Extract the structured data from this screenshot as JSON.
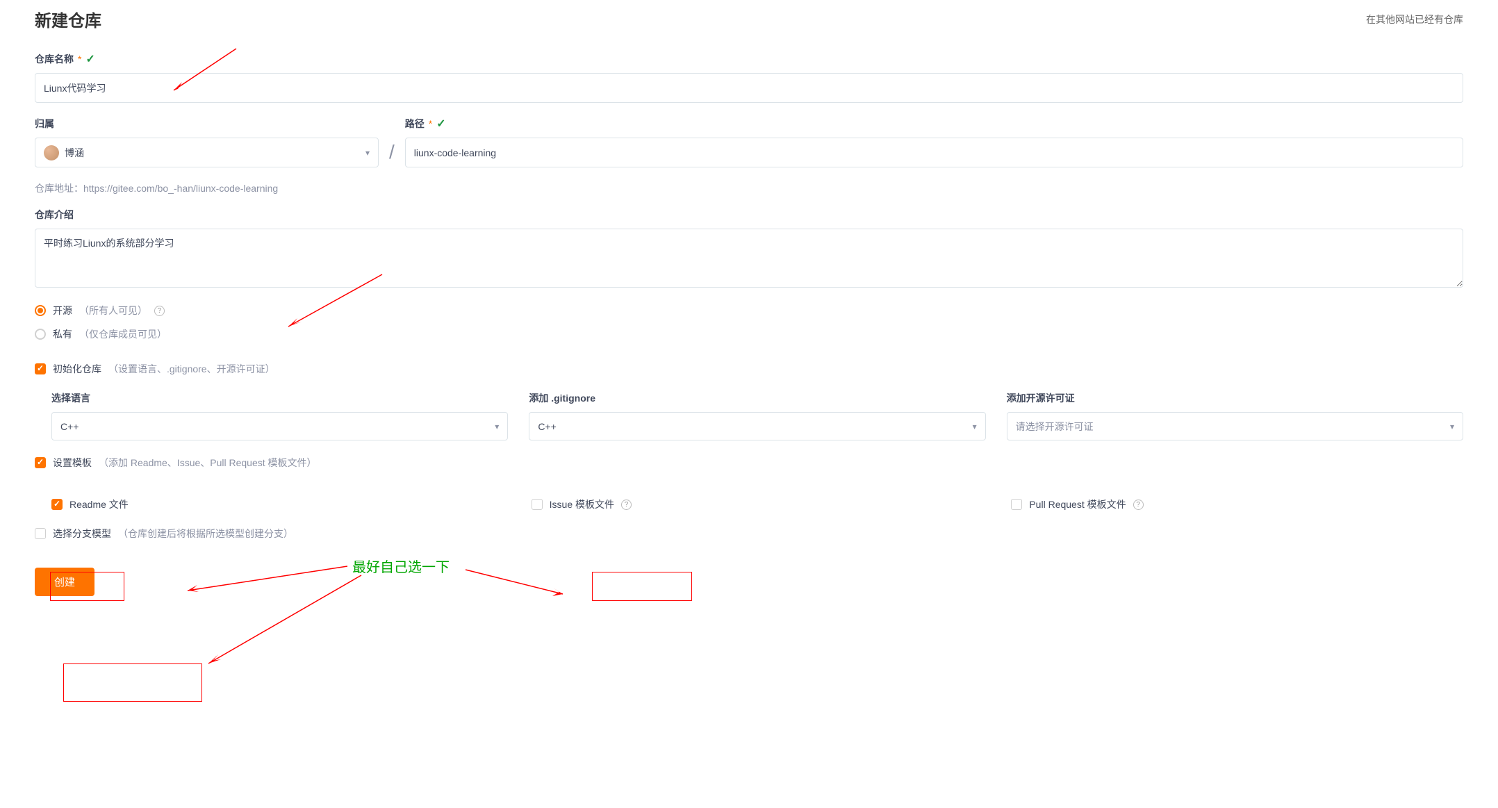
{
  "page": {
    "title": "新建仓库",
    "alt_link": "在其他网站已经有仓库"
  },
  "repo_name": {
    "label": "仓库名称",
    "value": "Liunx代码学习"
  },
  "owner": {
    "label": "归属",
    "value": "博涵"
  },
  "path": {
    "label": "路径",
    "value": "liunx-code-learning"
  },
  "repo_url": {
    "prefix": "仓库地址：",
    "url": "https://gitee.com/bo_-han/liunx-code-learning"
  },
  "description": {
    "label": "仓库介绍",
    "value": "平时练习Liunx的系统部分学习"
  },
  "visibility": {
    "public": {
      "label": "开源",
      "hint": "（所有人可见）"
    },
    "private": {
      "label": "私有",
      "hint": "（仅仓库成员可见）"
    }
  },
  "init_repo": {
    "label": "初始化仓库",
    "hint": "（设置语言、.gitignore、开源许可证）"
  },
  "language": {
    "label": "选择语言",
    "value": "C++"
  },
  "gitignore": {
    "label": "添加 .gitignore",
    "value": "C++"
  },
  "license": {
    "label": "添加开源许可证",
    "placeholder": "请选择开源许可证"
  },
  "template": {
    "label": "设置模板",
    "hint": "（添加 Readme、Issue、Pull Request 模板文件）",
    "readme": "Readme 文件",
    "issue": "Issue 模板文件",
    "pr": "Pull Request 模板文件"
  },
  "branch_model": {
    "label": "选择分支模型",
    "hint": "（仓库创建后将根据所选模型创建分支）"
  },
  "create_btn": "创建",
  "annotation": {
    "text": "最好自己选一下"
  }
}
